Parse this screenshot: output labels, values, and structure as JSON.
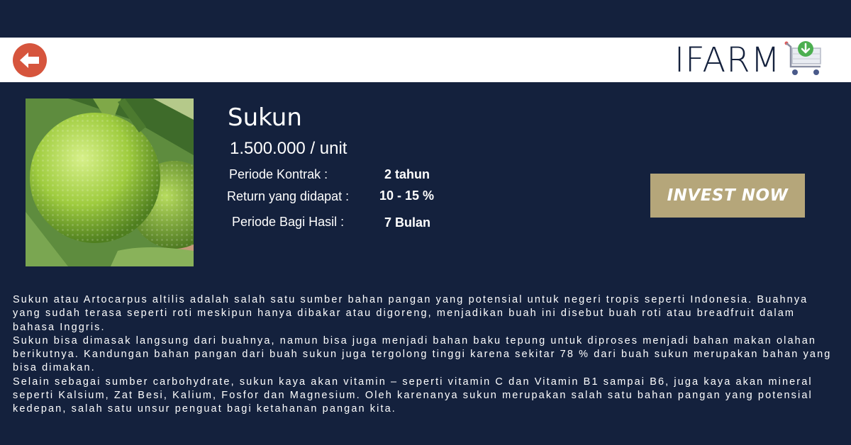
{
  "header": {
    "back_icon": "arrow-left-icon",
    "logo_text": "IFARM",
    "cart_icon": "cart-download-icon",
    "accent_back": "#d6553d",
    "accent_cart": "#4caf50"
  },
  "product": {
    "name": "Sukun",
    "price": "1.500.000 / unit",
    "details": [
      {
        "label": "Periode Kontrak :",
        "value": "2 tahun"
      },
      {
        "label": "Return yang didapat :",
        "value": "10 - 15 %"
      },
      {
        "label": "Periode Bagi Hasil :",
        "value": "7 Bulan"
      }
    ]
  },
  "cta": {
    "invest_label": "INVEST NOW",
    "color": "#b5a67a"
  },
  "description": [
    "Sukun atau Artocarpus altilis adalah salah satu sumber bahan pangan yang potensial untuk negeri tropis seperti Indonesia. Buahnya yang sudah terasa seperti roti meskipun hanya dibakar atau digoreng, menjadikan buah ini disebut buah roti atau breadfruit dalam bahasa Inggris.",
    "Sukun bisa dimasak langsung dari buahnya, namun bisa juga menjadi bahan baku tepung untuk diproses menjadi bahan makan olahan berikutnya. Kandungan bahan pangan dari buah sukun juga tergolong tinggi karena sekitar 78 % dari buah sukun merupakan bahan yang bisa dimakan.",
    "Selain sebagai sumber carbohydrate, sukun kaya akan vitamin – seperti vitamin C dan Vitamin B1 sampai B6, juga kaya akan mineral seperti Kalsium, Zat Besi, Kalium, Fosfor dan Magnesium. Oleh karenanya sukun merupakan salah satu bahan pangan yang potensial kedepan, salah satu unsur penguat bagi ketahanan pangan kita."
  ],
  "colors": {
    "background": "#14213d",
    "topbar": "#ffffff"
  }
}
